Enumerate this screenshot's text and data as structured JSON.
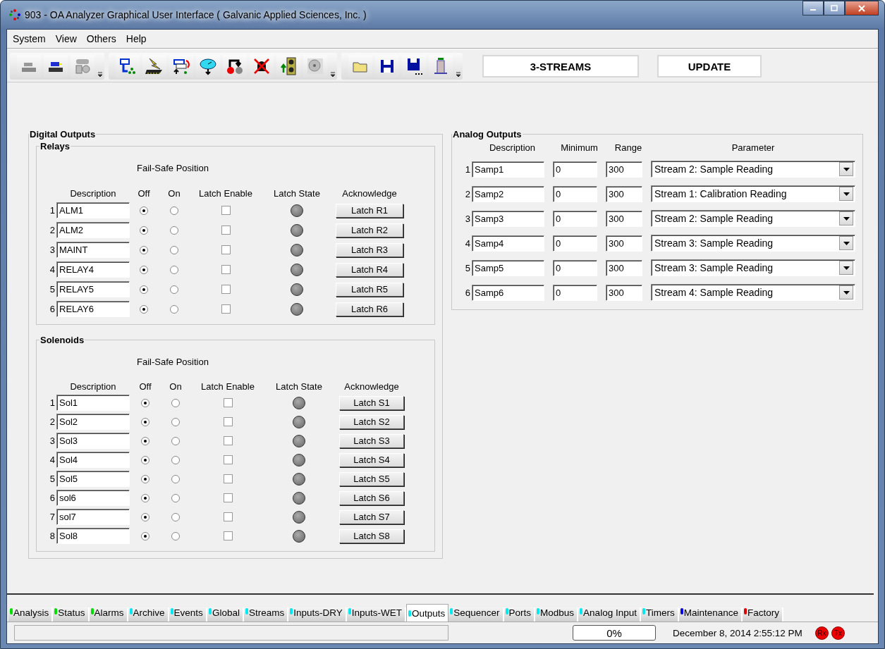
{
  "window": {
    "title": "903 - OA Analyzer Graphical User Interface  ( Galvanic Applied Sciences, Inc. )"
  },
  "menu": [
    "System",
    "View",
    "Others",
    "Help"
  ],
  "toolbar": {
    "labels": [
      "3-STREAMS",
      "UPDATE"
    ]
  },
  "digital_outputs": {
    "title": "Digital Outputs",
    "relays": {
      "title": "Relays",
      "fail_safe_header": "Fail-Safe Position",
      "columns": [
        "Description",
        "Off",
        "On",
        "Latch Enable",
        "Latch State",
        "Acknowledge"
      ],
      "rows": [
        {
          "number": "1",
          "description": "ALM1",
          "off_selected": true,
          "on_selected": false,
          "latch_enabled": false,
          "button": "Latch R1"
        },
        {
          "number": "2",
          "description": "ALM2",
          "off_selected": true,
          "on_selected": false,
          "latch_enabled": false,
          "button": "Latch R2"
        },
        {
          "number": "3",
          "description": "MAINT",
          "off_selected": true,
          "on_selected": false,
          "latch_enabled": false,
          "button": "Latch R3"
        },
        {
          "number": "4",
          "description": "RELAY4",
          "off_selected": true,
          "on_selected": false,
          "latch_enabled": false,
          "button": "Latch R4"
        },
        {
          "number": "5",
          "description": "RELAY5",
          "off_selected": true,
          "on_selected": false,
          "latch_enabled": false,
          "button": "Latch R5"
        },
        {
          "number": "6",
          "description": "RELAY6",
          "off_selected": true,
          "on_selected": false,
          "latch_enabled": false,
          "button": "Latch R6"
        }
      ]
    },
    "solenoids": {
      "title": "Solenoids",
      "fail_safe_header": "Fail-Safe Position",
      "columns": [
        "Description",
        "Off",
        "On",
        "Latch Enable",
        "Latch State",
        "Acknowledge"
      ],
      "rows": [
        {
          "number": "1",
          "description": "Sol1",
          "off_selected": true,
          "on_selected": false,
          "latch_enabled": false,
          "button": "Latch S1"
        },
        {
          "number": "2",
          "description": "Sol2",
          "off_selected": true,
          "on_selected": false,
          "latch_enabled": false,
          "button": "Latch S2"
        },
        {
          "number": "3",
          "description": "Sol3",
          "off_selected": true,
          "on_selected": false,
          "latch_enabled": false,
          "button": "Latch S3"
        },
        {
          "number": "4",
          "description": "Sol4",
          "off_selected": true,
          "on_selected": false,
          "latch_enabled": false,
          "button": "Latch S4"
        },
        {
          "number": "5",
          "description": "Sol5",
          "off_selected": true,
          "on_selected": false,
          "latch_enabled": false,
          "button": "Latch S5"
        },
        {
          "number": "6",
          "description": "sol6",
          "off_selected": true,
          "on_selected": false,
          "latch_enabled": false,
          "button": "Latch S6"
        },
        {
          "number": "7",
          "description": "sol7",
          "off_selected": true,
          "on_selected": false,
          "latch_enabled": false,
          "button": "Latch S7"
        },
        {
          "number": "8",
          "description": "Sol8",
          "off_selected": true,
          "on_selected": false,
          "latch_enabled": false,
          "button": "Latch S8"
        }
      ]
    }
  },
  "analog_outputs": {
    "title": "Analog Outputs",
    "columns": [
      "Description",
      "Minimum",
      "Range",
      "Parameter"
    ],
    "rows": [
      {
        "number": "1",
        "description": "Samp1",
        "minimum": "0",
        "range": "300",
        "parameter": "Stream 2: Sample Reading"
      },
      {
        "number": "2",
        "description": "Samp2",
        "minimum": "0",
        "range": "300",
        "parameter": "Stream 1: Calibration Reading"
      },
      {
        "number": "3",
        "description": "Samp3",
        "minimum": "0",
        "range": "300",
        "parameter": "Stream 2: Sample Reading"
      },
      {
        "number": "4",
        "description": "Samp4",
        "minimum": "0",
        "range": "300",
        "parameter": "Stream 3: Sample Reading"
      },
      {
        "number": "5",
        "description": "Samp5",
        "minimum": "0",
        "range": "300",
        "parameter": "Stream 3: Sample Reading"
      },
      {
        "number": "6",
        "description": "Samp6",
        "minimum": "0",
        "range": "300",
        "parameter": "Stream 4: Sample Reading"
      }
    ]
  },
  "tabs": [
    {
      "label": "Analysis",
      "color": "#00e000",
      "selected": false
    },
    {
      "label": "Status",
      "color": "#00e000",
      "selected": false
    },
    {
      "label": "Alarms",
      "color": "#00e000",
      "selected": false
    },
    {
      "label": "Archive",
      "color": "#00e8f0",
      "selected": false
    },
    {
      "label": "Events",
      "color": "#00e8f0",
      "selected": false
    },
    {
      "label": "Global",
      "color": "#00e8f0",
      "selected": false
    },
    {
      "label": "Streams",
      "color": "#00e8f0",
      "selected": false
    },
    {
      "label": "Inputs-DRY",
      "color": "#00e8f0",
      "selected": false
    },
    {
      "label": "Inputs-WET",
      "color": "#00e8f0",
      "selected": false
    },
    {
      "label": "Outputs",
      "color": "#00e8f0",
      "selected": true
    },
    {
      "label": "Sequencer",
      "color": "#00e8f0",
      "selected": false
    },
    {
      "label": "Ports",
      "color": "#00e8f0",
      "selected": false
    },
    {
      "label": "Modbus",
      "color": "#00e8f0",
      "selected": false
    },
    {
      "label": "Analog Input",
      "color": "#00e8f0",
      "selected": false
    },
    {
      "label": "Timers",
      "color": "#00e8f0",
      "selected": false
    },
    {
      "label": "Maintenance",
      "color": "#0000e0",
      "selected": false
    },
    {
      "label": "Factory",
      "color": "#e00000",
      "selected": false
    }
  ],
  "status_bar": {
    "progress": "0%",
    "datetime": "December 8, 2014 2:55:12 PM",
    "rx": "Rx",
    "tx": "Tx"
  }
}
